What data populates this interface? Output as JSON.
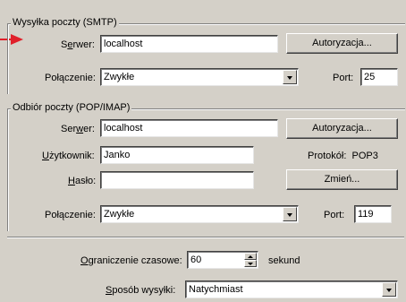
{
  "colors": {
    "background": "#d4d0c8",
    "arrow": "#e0202a"
  },
  "smtp": {
    "title": "Wysyłka poczty (SMTP)",
    "server_label_prefix": "S",
    "server_label_u": "e",
    "server_label_rest": "rwer:",
    "server_value": "localhost",
    "auth_button": "Autoryzacja...",
    "connection_label": "Połączenie:",
    "connection_value": "Zwykłe",
    "port_label": "Port:",
    "port_value": "25"
  },
  "pop": {
    "title": "Odbiór poczty (POP/IMAP)",
    "server_label_prefix": "Ser",
    "server_label_u": "w",
    "server_label_rest": "er:",
    "server_value": "localhost",
    "auth_button": "Autoryzacja...",
    "user_label_u": "U",
    "user_label_rest": "żytkownik:",
    "user_value": "Janko",
    "protocol_text": "Protokół:  POP3",
    "password_label_u": "H",
    "password_label_rest": "asło:",
    "password_value": "",
    "change_button": "Zmień...",
    "connection_label": "Połączenie:",
    "connection_value": "Zwykłe",
    "port_label": "Port:",
    "port_value": "119"
  },
  "misc": {
    "timeout_label_u": "O",
    "timeout_label_rest": "graniczenie czasowe:",
    "timeout_value": "60",
    "timeout_unit": "sekund",
    "send_mode_label_u": "S",
    "send_mode_label_rest": "posób wysyłki:",
    "send_mode_value": "Natychmiast"
  }
}
